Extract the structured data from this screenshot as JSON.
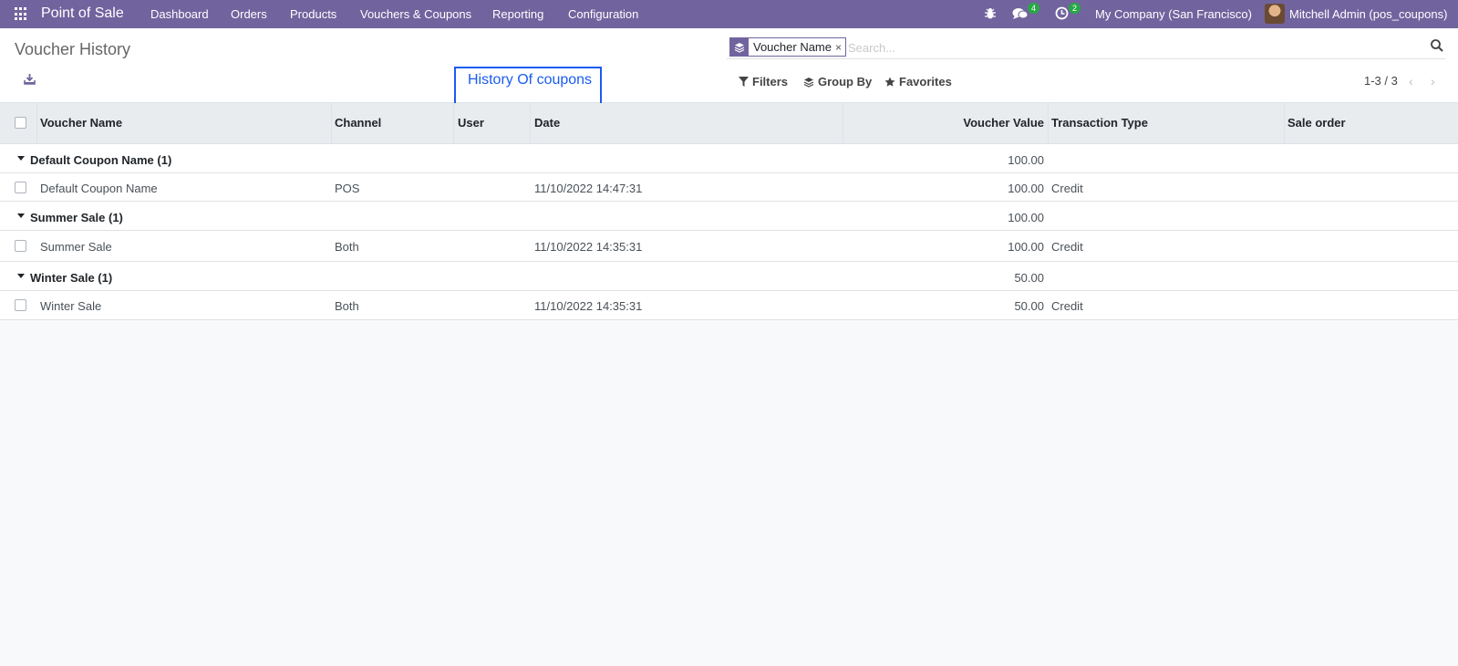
{
  "navbar": {
    "app_name": "Point of Sale",
    "menus": [
      "Dashboard",
      "Orders",
      "Products",
      "Vouchers & Coupons",
      "Reporting",
      "Configuration"
    ],
    "messages_count": "4",
    "activities_count": "2",
    "company": "My Company (San Francisco)",
    "user": "Mitchell Admin (pos_coupons)"
  },
  "control_panel": {
    "title": "Voucher History",
    "annotation": "History Of coupons",
    "search": {
      "facet_value": "Voucher Name",
      "facet_remove": "×",
      "placeholder": "Search..."
    },
    "filters_label": "Filters",
    "groupby_label": "Group By",
    "favorites_label": "Favorites",
    "pager": "1-3 / 3"
  },
  "table": {
    "columns": [
      "Voucher Name",
      "Channel",
      "User",
      "Date",
      "Voucher Value",
      "Transaction Type",
      "Sale order"
    ],
    "groups": [
      {
        "label": "Default Coupon Name (1)",
        "total": "100.00",
        "record": {
          "name": "Default Coupon Name",
          "channel": "POS",
          "user": "",
          "date": "11/10/2022 14:47:31",
          "value": "100.00",
          "type": "Credit",
          "sale_order": ""
        }
      },
      {
        "label": "Summer Sale (1)",
        "total": "100.00",
        "record": {
          "name": "Summer Sale",
          "channel": "Both",
          "user": "",
          "date": "11/10/2022 14:35:31",
          "value": "100.00",
          "type": "Credit",
          "sale_order": ""
        }
      },
      {
        "label": "Winter Sale (1)",
        "total": "50.00",
        "record": {
          "name": "Winter Sale",
          "channel": "Both",
          "user": "",
          "date": "11/10/2022 14:35:31",
          "value": "50.00",
          "type": "Credit",
          "sale_order": ""
        }
      }
    ]
  },
  "colors": {
    "navbar": "#71639e",
    "annotation": "#1a5cf2",
    "badge": "#28a745"
  }
}
